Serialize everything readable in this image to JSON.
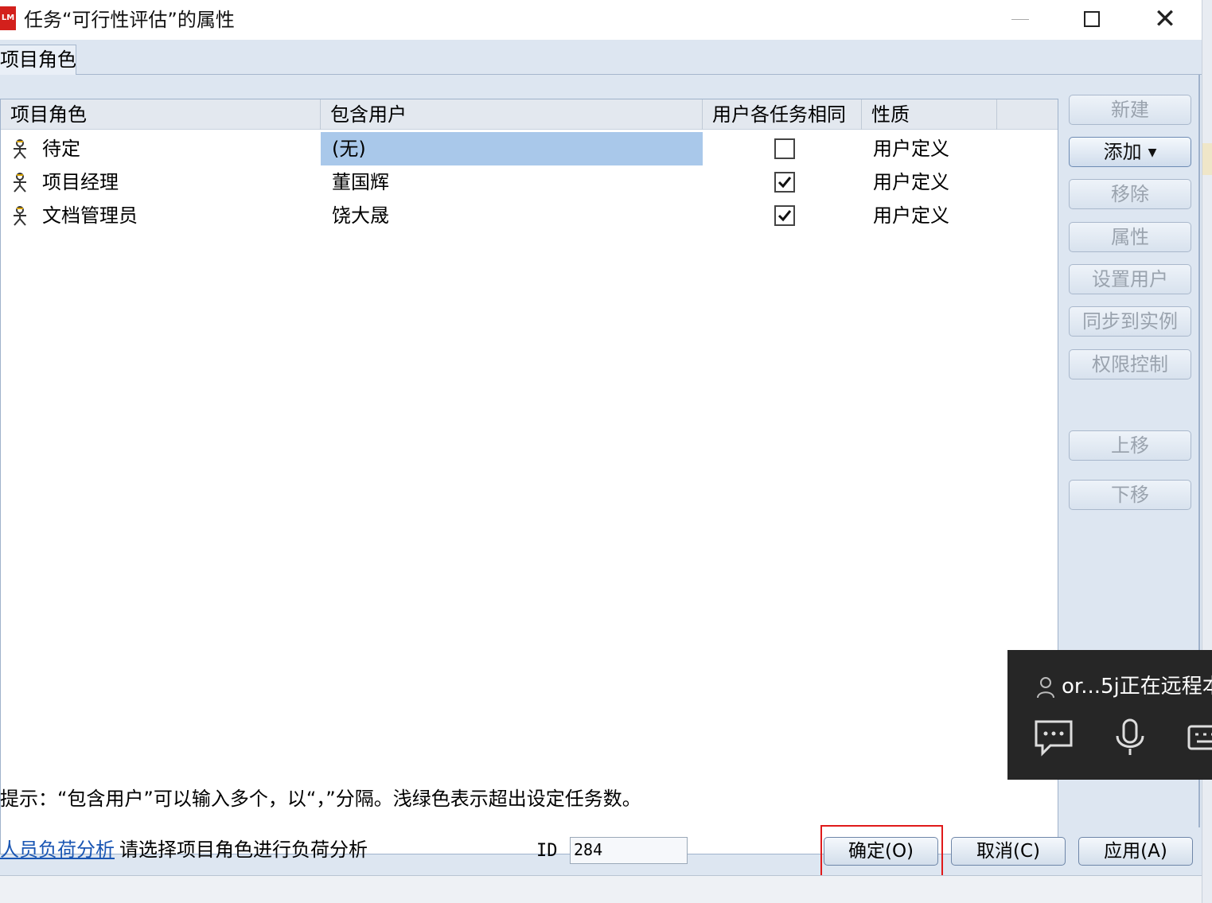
{
  "window": {
    "app_logo": "LM",
    "title": "任务“可行性评估”的属性"
  },
  "tabs": [
    {
      "label": "项目角色"
    }
  ],
  "grid": {
    "columns": [
      "项目角色",
      "包含用户",
      "用户各任务相同",
      "性质"
    ],
    "rows": [
      {
        "role": "待定",
        "users": "(无)",
        "same": false,
        "nature": "用户定义",
        "selected": true
      },
      {
        "role": "项目经理",
        "users": "董国辉",
        "same": true,
        "nature": "用户定义",
        "selected": false
      },
      {
        "role": "文档管理员",
        "users": "饶大晟",
        "same": true,
        "nature": "用户定义",
        "selected": false
      }
    ]
  },
  "side_buttons": {
    "new": "新建",
    "add": "添加",
    "remove": "移除",
    "properties": "属性",
    "set_users": "设置用户",
    "sync": "同步到实例",
    "permissions": "权限控制",
    "move_up": "上移",
    "move_down": "下移"
  },
  "hint": "提示：“包含用户”可以输入多个，以“，”分隔。浅绿色表示超出设定任务数。",
  "footer": {
    "load_link": "人员负荷分析",
    "load_text": "请选择项目角色进行负荷分析",
    "id_label": "ID",
    "id_value": "284",
    "ok": "确定(O)",
    "cancel": "取消(C)",
    "apply": "应用(A)"
  },
  "remote_session": {
    "user_text": "or...5j正在远程本"
  },
  "colors": {
    "selection": "#a9c8ea",
    "panel": "#dde6f1",
    "focus_highlight": "#e01a1a",
    "overlay": "#262626"
  }
}
